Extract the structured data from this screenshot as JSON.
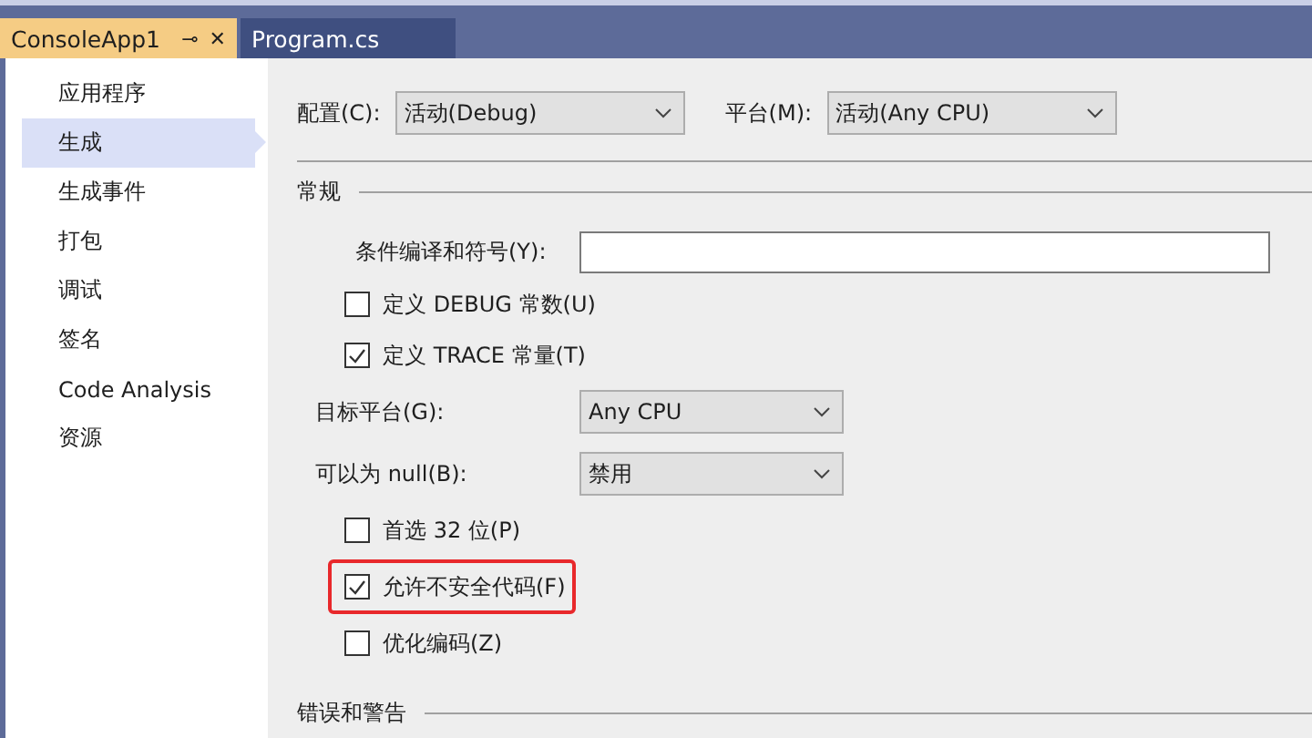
{
  "tabs": [
    {
      "label": "ConsoleApp1",
      "selected": true,
      "pin": "⊸",
      "close": "✕"
    },
    {
      "label": "Program.cs",
      "selected": false
    }
  ],
  "sidebar": {
    "items": [
      {
        "label": "应用程序",
        "selected": false
      },
      {
        "label": "生成",
        "selected": true
      },
      {
        "label": "生成事件",
        "selected": false
      },
      {
        "label": "打包",
        "selected": false
      },
      {
        "label": "调试",
        "selected": false
      },
      {
        "label": "签名",
        "selected": false
      },
      {
        "label": "Code Analysis",
        "selected": false
      },
      {
        "label": "资源",
        "selected": false
      }
    ]
  },
  "config_bar": [
    {
      "label": "配置(C):",
      "value": "活动(Debug)"
    },
    {
      "label": "平台(M):",
      "value": "活动(Any CPU)"
    }
  ],
  "sections": [
    {
      "title": "常规",
      "items": [
        {
          "kind": "text",
          "label": "条件编译和符号(Y):",
          "value": ""
        },
        {
          "kind": "checkbox",
          "label": "定义 DEBUG 常数(U)",
          "checked": false,
          "highlighted": false
        },
        {
          "kind": "checkbox",
          "label": "定义 TRACE 常量(T)",
          "checked": true,
          "highlighted": false
        },
        {
          "kind": "dropdown",
          "label": "目标平台(G):",
          "value": "Any CPU"
        },
        {
          "kind": "dropdown",
          "label": "可以为 null(B):",
          "value": "禁用"
        },
        {
          "kind": "checkbox",
          "label": "首选 32 位(P)",
          "checked": false,
          "highlighted": false
        },
        {
          "kind": "checkbox",
          "label": "允许不安全代码(F)",
          "checked": true,
          "highlighted": true
        },
        {
          "kind": "checkbox",
          "label": "优化编码(Z)",
          "checked": false,
          "highlighted": false
        }
      ]
    },
    {
      "title": "错误和警告"
    }
  ]
}
